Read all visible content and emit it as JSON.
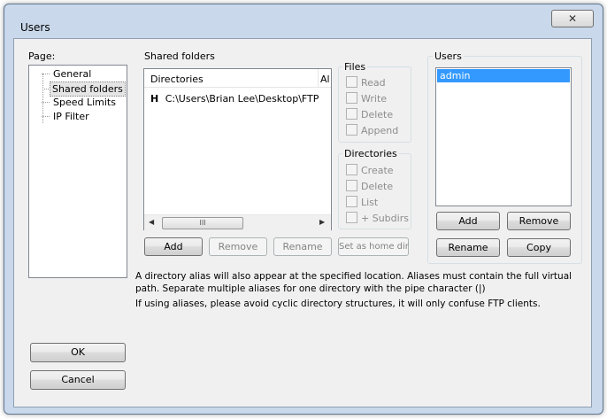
{
  "window": {
    "title": "Users",
    "close_glyph": "✕"
  },
  "page_panel": {
    "label": "Page:",
    "items": [
      "General",
      "Shared folders",
      "Speed Limits",
      "IP Filter"
    ],
    "selected_index": 1
  },
  "shared_folders": {
    "group_label": "Shared folders",
    "columns": [
      "Directories",
      "Al"
    ],
    "rows": [
      {
        "flag": "H",
        "path": "C:\\Users\\Brian Lee\\Desktop\\FTP"
      }
    ],
    "scroll_thumb": "III",
    "buttons": {
      "add": "Add",
      "remove": "Remove",
      "rename": "Rename",
      "set_home": "Set as home dir"
    }
  },
  "files_group": {
    "label": "Files",
    "options": [
      "Read",
      "Write",
      "Delete",
      "Append"
    ]
  },
  "directories_group": {
    "label": "Directories",
    "options": [
      "Create",
      "Delete",
      "List",
      "+ Subdirs"
    ]
  },
  "users_panel": {
    "label": "Users",
    "items": [
      "admin"
    ],
    "selected_index": 0,
    "buttons": {
      "add": "Add",
      "remove": "Remove",
      "rename": "Rename",
      "copy": "Copy"
    }
  },
  "info": {
    "line1": "A directory alias will also appear at the specified location. Aliases must contain the full virtual",
    "line2": "path. Separate multiple aliases for one directory with the pipe character (|)",
    "line3": "If using aliases, please avoid cyclic directory structures, it will only confuse FTP clients."
  },
  "dialog_buttons": {
    "ok": "OK",
    "cancel": "Cancel"
  }
}
